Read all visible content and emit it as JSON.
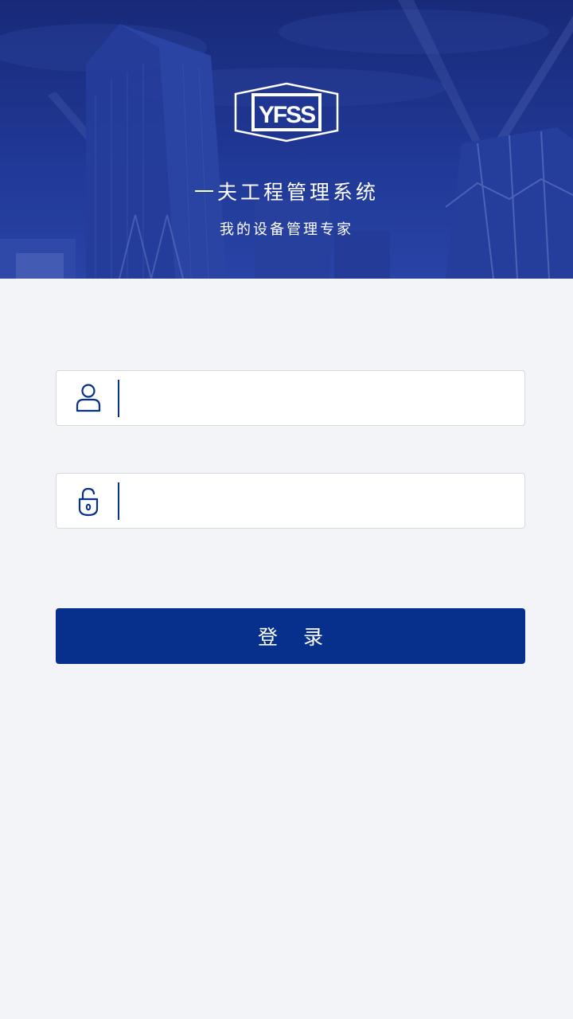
{
  "header": {
    "logo_text": "YFSS",
    "title": "一夫工程管理系统",
    "subtitle": "我的设备管理专家",
    "background_image": "city-skyline-night"
  },
  "form": {
    "username": {
      "icon": "user-icon",
      "value": "",
      "placeholder": ""
    },
    "password": {
      "icon": "lock-icon",
      "value": "",
      "placeholder": ""
    },
    "login_label": "登 录"
  },
  "colors": {
    "primary": "#06308c",
    "background": "#f3f4f8",
    "hero_overlay": "#22399a"
  }
}
